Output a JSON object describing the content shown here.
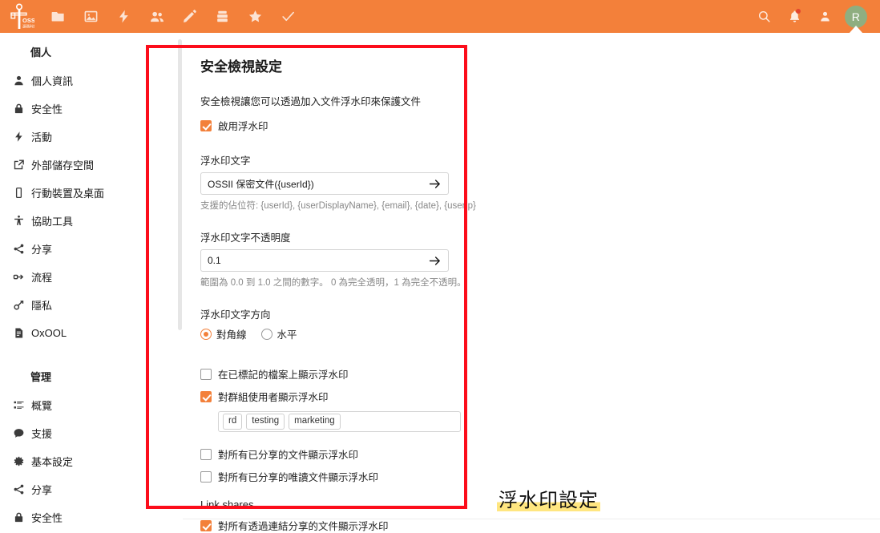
{
  "topbar": {
    "logo_text": "OSS",
    "logo_subtext": "源碼科技",
    "nav_items": [
      {
        "name": "files-icon",
        "label": "檔案"
      },
      {
        "name": "photos-icon",
        "label": "相片"
      },
      {
        "name": "activity-icon",
        "label": "活動"
      },
      {
        "name": "contacts-icon",
        "label": "聯絡人"
      },
      {
        "name": "notes-icon",
        "label": "記事"
      },
      {
        "name": "deck-icon",
        "label": "Deck"
      },
      {
        "name": "favorites-icon",
        "label": "我的最愛"
      },
      {
        "name": "tasks-icon",
        "label": "工作"
      }
    ],
    "right_items": [
      {
        "name": "search-icon",
        "label": "搜尋"
      },
      {
        "name": "notifications-icon",
        "label": "通知",
        "badge": true
      },
      {
        "name": "contacts-menu-icon",
        "label": "聯絡人選單"
      }
    ],
    "avatar_initial": "R",
    "accent_color": "#f3803a",
    "avatar_color": "#8fae80",
    "badge_color": "#e03b2f"
  },
  "sidebar": {
    "groups": [
      {
        "header": "個人",
        "items": [
          {
            "icon": "user-icon",
            "label": "個人資訊"
          },
          {
            "icon": "lock-icon",
            "label": "安全性"
          },
          {
            "icon": "activity-icon",
            "label": "活動"
          },
          {
            "icon": "external-storage-icon",
            "label": "外部儲存空間"
          },
          {
            "icon": "mobile-desktop-icon",
            "label": "行動裝置及桌面"
          },
          {
            "icon": "accessibility-icon",
            "label": "協助工具"
          },
          {
            "icon": "share-icon",
            "label": "分享"
          },
          {
            "icon": "flow-icon",
            "label": "流程"
          },
          {
            "icon": "privacy-key-icon",
            "label": "隱私"
          },
          {
            "icon": "document-icon",
            "label": "OxOOL"
          }
        ]
      },
      {
        "header": "管理",
        "items": [
          {
            "icon": "overview-icon",
            "label": "概覽"
          },
          {
            "icon": "support-icon",
            "label": "支援"
          },
          {
            "icon": "gear-icon",
            "label": "基本設定"
          },
          {
            "icon": "share-icon",
            "label": "分享"
          },
          {
            "icon": "lock-icon",
            "label": "安全性"
          }
        ]
      }
    ]
  },
  "panel": {
    "title": "安全檢視設定",
    "description": "安全檢視讓您可以透過加入文件浮水印來保護文件",
    "enable_watermark": {
      "label": "啟用浮水印",
      "checked": true
    },
    "watermark_text": {
      "label": "浮水印文字",
      "value": "OSSII 保密文件({userId})",
      "placeholder": "浮水印文字",
      "hint": "支援的佔位符: {userId}, {userDisplayName}, {email}, {date}, {userIp}"
    },
    "watermark_opacity": {
      "label": "浮水印文字不透明度",
      "value": "0.1",
      "placeholder": "0.1",
      "hint": "範圍為 0.0 到 1.0 之間的數字。 0 為完全透明，1 為完全不透明。"
    },
    "watermark_direction": {
      "label": "浮水印文字方向",
      "options": [
        {
          "label": "對角線",
          "selected": true
        },
        {
          "label": "水平",
          "selected": false
        }
      ]
    },
    "checkboxes": [
      {
        "label": "在已標記的檔案上顯示浮水印",
        "checked": false
      },
      {
        "label": "對群組使用者顯示浮水印",
        "checked": true
      }
    ],
    "group_tags": [
      "rd",
      "testing",
      "marketing"
    ],
    "checkboxes_tail": [
      {
        "label": "對所有已分享的文件顯示浮水印",
        "checked": false
      },
      {
        "label": "對所有已分享的唯讀文件顯示浮水印",
        "checked": false
      }
    ],
    "link_shares": {
      "header": "Link shares",
      "checkbox": {
        "label": "對所有透過連結分享的文件顯示浮水印",
        "checked": true
      }
    }
  },
  "annotation": {
    "text": "浮水印設定",
    "highlight_color": "#ffe680"
  },
  "redbox": {
    "color": "#fc0d1b"
  }
}
